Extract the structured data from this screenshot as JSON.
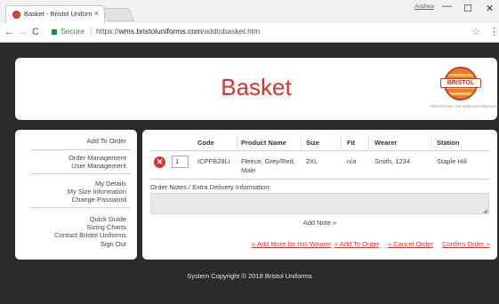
{
  "browser": {
    "tab_title": "Basket - Bristol Uniforms",
    "profile": "Andrew",
    "secure_label": "Secure",
    "url_scheme": "https://",
    "url_host": "wms.bristoluniforms.com",
    "url_path": "/addtobasket.htm",
    "icons": {
      "tab_close": "close-icon",
      "back": "back-arrow-icon",
      "forward": "forward-arrow-icon",
      "reload": "reload-icon",
      "lock": "lock-icon",
      "bookmark": "star-icon",
      "menu": "kebab-menu-icon",
      "minimize": "minimize-icon",
      "maximize": "maximize-icon",
      "close": "close-window-icon"
    }
  },
  "header": {
    "title": "Basket",
    "logo_text": "BRISTOL",
    "logo_tagline": "PROTECTING THE WORLD'S FIREFIGHTERS"
  },
  "sidebar": {
    "items": [
      "Add To Order",
      "Order Management",
      "User Management",
      "My Details",
      "My Size Information",
      "Change Password",
      "Quick Guide",
      "Sizing Charts",
      "Contact Bristol Uniforms",
      "Sign Out"
    ]
  },
  "basket": {
    "columns": [
      "Code",
      "Product Name",
      "Size",
      "Fit",
      "Wearer",
      "Station"
    ],
    "rows": [
      {
        "quantity": "1",
        "code": "ICPFB28LI",
        "product_name_line1": "Fleece, Grey/Red,",
        "product_name_line2": "Male",
        "size": "2XL",
        "fit": "n/a",
        "wearer": "Smith, 1234",
        "station": "Staple Hill"
      }
    ],
    "notes_label": "Order Notes / Extra Delivery Information:",
    "notes_value": "",
    "add_note": "Add Note »",
    "actions": {
      "add_more": "« Add More for this Wearer",
      "add_to_order": "« Add To Order",
      "cancel_order": "« Cancel Order",
      "confirm_order": "Confirm Order »"
    }
  },
  "footer": {
    "copyright": "System Copyright © 2018 Bristol Uniforms"
  },
  "colors": {
    "accent": "#d9322f",
    "page_background": "#2b2b2b",
    "secure": "#1e8e3e"
  }
}
